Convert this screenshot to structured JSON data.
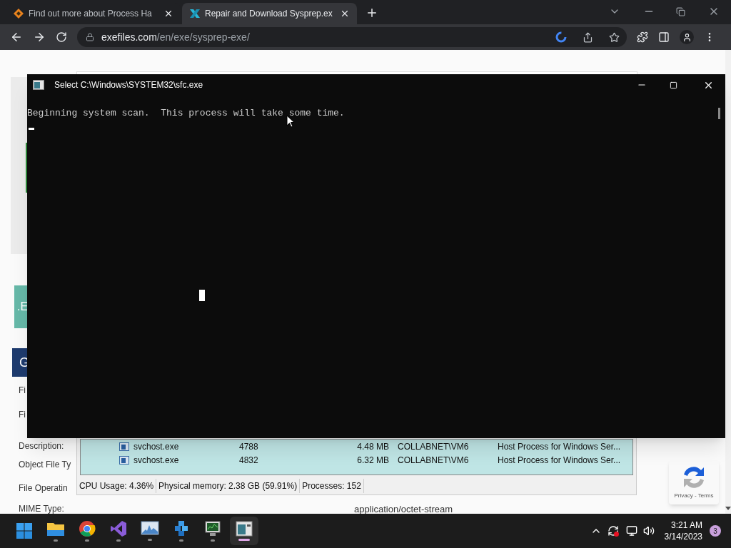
{
  "browser": {
    "tabs": [
      {
        "title": "Find out more about Process Ha",
        "kind": "diamond",
        "selected": false
      },
      {
        "title": "Repair and Download Sysprep.ex",
        "kind": "x-logo",
        "selected": true
      }
    ],
    "address": {
      "domain": "exefiles.com",
      "path": "/en/exe/sysprep-exe/"
    }
  },
  "page": {
    "banner_text": ".E",
    "header_text": "G",
    "labels": [
      "Fi",
      "Fi",
      "Description:",
      "Object File Ty",
      "File Operatin",
      "MIME Type:"
    ],
    "mime_value": "application/octet-stream",
    "captcha": "Privacy - Terms"
  },
  "process_window": {
    "rows": [
      {
        "name": "svchost.exe",
        "pid": "4788",
        "memory": "4.48 MB",
        "user": "COLLABNET\\VM6",
        "description": "Host Process for Windows Ser..."
      },
      {
        "name": "svchost.exe",
        "pid": "4832",
        "memory": "6.32 MB",
        "user": "COLLABNET\\VM6",
        "description": "Host Process for Windows Ser..."
      }
    ],
    "status": [
      "CPU Usage: 4.36%",
      "Physical memory: 2.38 GB (59.91%)",
      "Processes: 152"
    ]
  },
  "console": {
    "title": "Select C:\\Windows\\SYSTEM32\\sfc.exe",
    "lines": [
      "Beginning system scan.  This process will take some time."
    ]
  },
  "taskbar": {
    "apps": [
      {
        "kind": "start",
        "selected": false
      },
      {
        "kind": "folder",
        "selected": false
      },
      {
        "kind": "chrome",
        "selected": false
      },
      {
        "kind": "studio",
        "selected": false
      },
      {
        "kind": "monitor",
        "selected": false
      },
      {
        "kind": "cubes",
        "selected": false
      },
      {
        "kind": "taskmgr",
        "selected": false
      },
      {
        "kind": "console",
        "selected": true
      }
    ],
    "time": "3:21 AM",
    "date": "3/14/2023",
    "notifications": "3"
  }
}
